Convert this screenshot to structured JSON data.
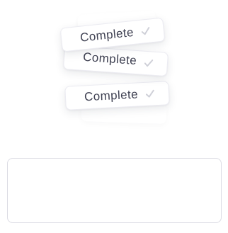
{
  "badges": [
    {
      "label": "Complete",
      "icon": "check-icon"
    },
    {
      "label": "Complete",
      "icon": "check-icon"
    },
    {
      "label": "Complete",
      "icon": "check-icon"
    }
  ],
  "colors": {
    "text": "#3f4152",
    "check": "#cfd0d8",
    "border": "#dcdce4"
  }
}
